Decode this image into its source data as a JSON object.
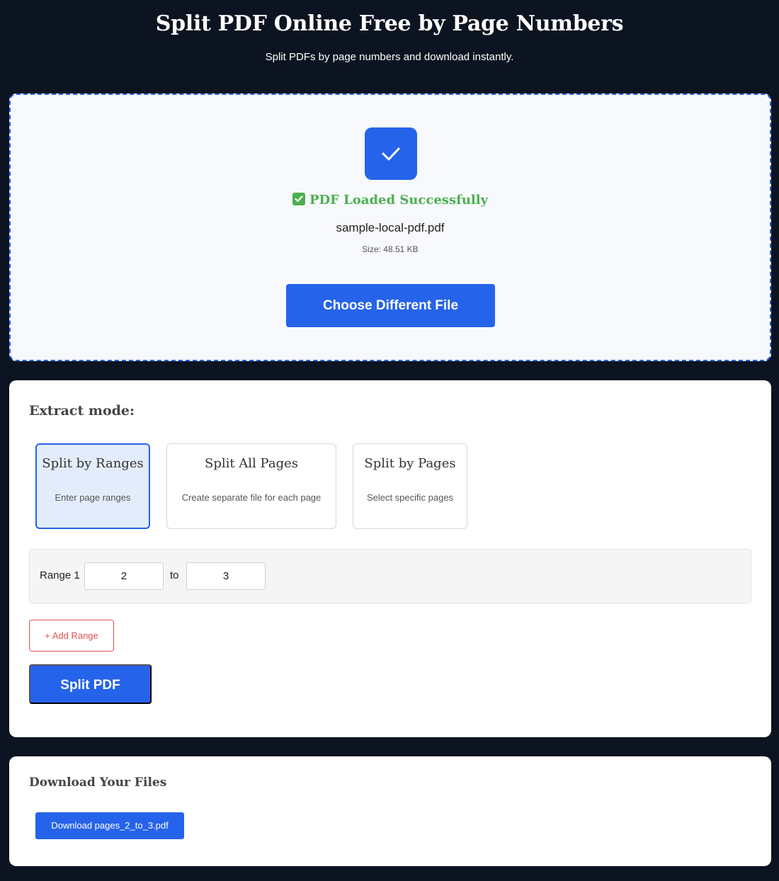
{
  "header": {
    "title": "Split PDF Online Free by Page Numbers",
    "subtitle": "Split PDFs by page numbers and download instantly."
  },
  "upload": {
    "status_text": "PDF Loaded Successfully",
    "file_name": "sample-local-pdf.pdf",
    "file_size": "Size: 48.51 KB",
    "choose_button": "Choose Different File"
  },
  "extract": {
    "heading": "Extract mode:",
    "modes": [
      {
        "title": "Split by Ranges",
        "desc": "Enter page ranges",
        "active": true
      },
      {
        "title": "Split All Pages",
        "desc": "Create separate file for each page",
        "active": false
      },
      {
        "title": "Split by Pages",
        "desc": "Select specific pages",
        "active": false
      }
    ],
    "range": {
      "label": "Range 1",
      "from": "2",
      "to_label": "to",
      "to": "3"
    },
    "add_range_button": "+ Add Range",
    "split_button": "Split PDF"
  },
  "download": {
    "heading": "Download Your Files",
    "link_label": "Download pages_2_to_3.pdf"
  },
  "colors": {
    "background": "#0d1421",
    "accent": "#2563eb",
    "success": "#4caf50",
    "danger": "#e05050"
  }
}
